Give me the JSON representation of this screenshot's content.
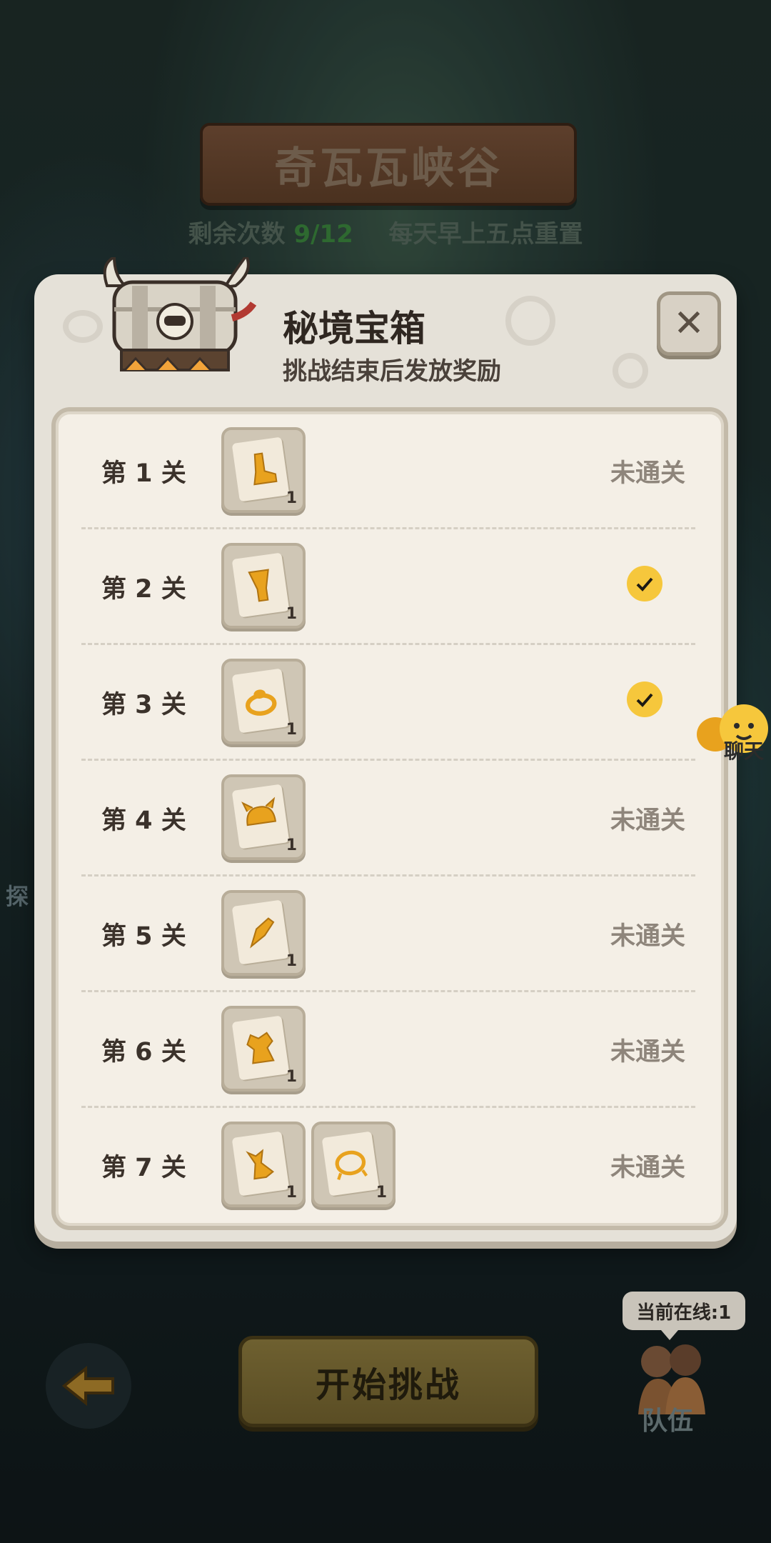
{
  "header": {
    "title": "奇瓦瓦峡谷",
    "remaining_label": "剩余次数",
    "remaining_count": "9/12",
    "reset_note": "每天早上五点重置"
  },
  "modal": {
    "title": "秘境宝箱",
    "subtitle": "挑战结束后发放奖励",
    "close_label": "✕",
    "stages": [
      {
        "label": "第 1 关",
        "rewards": [
          {
            "icon": "boot-icon",
            "qty": "1"
          }
        ],
        "status": "未通关",
        "cleared": false
      },
      {
        "label": "第 2 关",
        "rewards": [
          {
            "icon": "glove-icon",
            "qty": "1"
          }
        ],
        "status": "",
        "cleared": true
      },
      {
        "label": "第 3 关",
        "rewards": [
          {
            "icon": "ring-icon",
            "qty": "1"
          }
        ],
        "status": "",
        "cleared": true
      },
      {
        "label": "第 4 关",
        "rewards": [
          {
            "icon": "helmet-icon",
            "qty": "1"
          }
        ],
        "status": "未通关",
        "cleared": false
      },
      {
        "label": "第 5 关",
        "rewards": [
          {
            "icon": "weapon-icon",
            "qty": "1"
          }
        ],
        "status": "未通关",
        "cleared": false
      },
      {
        "label": "第 6 关",
        "rewards": [
          {
            "icon": "armor-icon",
            "qty": "1"
          }
        ],
        "status": "未通关",
        "cleared": false
      },
      {
        "label": "第 7 关",
        "rewards": [
          {
            "icon": "cape-icon",
            "qty": "1"
          },
          {
            "icon": "necklace-icon",
            "qty": "1"
          }
        ],
        "status": "未通关",
        "cleared": false
      }
    ]
  },
  "chat": {
    "label": "聊天"
  },
  "side_hint": "探",
  "footer": {
    "start_label": "开始挑战",
    "online_label": "当前在线:1",
    "team_label": "队伍"
  },
  "colors": {
    "check": "#f6c73c",
    "count": "#2e6930",
    "panel": "#f4efe6"
  }
}
